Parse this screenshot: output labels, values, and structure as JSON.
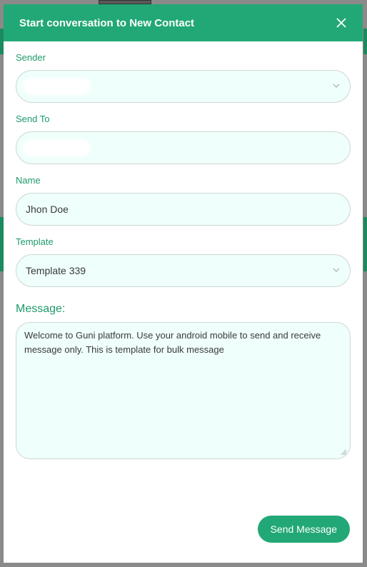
{
  "modal": {
    "title": "Start conversation to New Contact"
  },
  "form": {
    "sender_label": "Sender",
    "send_to_label": "Send To",
    "name_label": "Name",
    "name_value": "Jhon Doe",
    "template_label": "Template",
    "template_value": "Template 339",
    "message_label": "Message:",
    "message_value": "Welcome to Guni platform. Use your android mobile to send and receive message only. This is template for bulk message"
  },
  "actions": {
    "send_label": "Send Message"
  },
  "icons": {
    "close": "close-icon",
    "dropdown": "chevron-down-icon",
    "resize": "resize-grip-icon"
  },
  "colors": {
    "accent": "#22a876",
    "label": "#1e9a6a",
    "field_bg": "#effffb"
  }
}
